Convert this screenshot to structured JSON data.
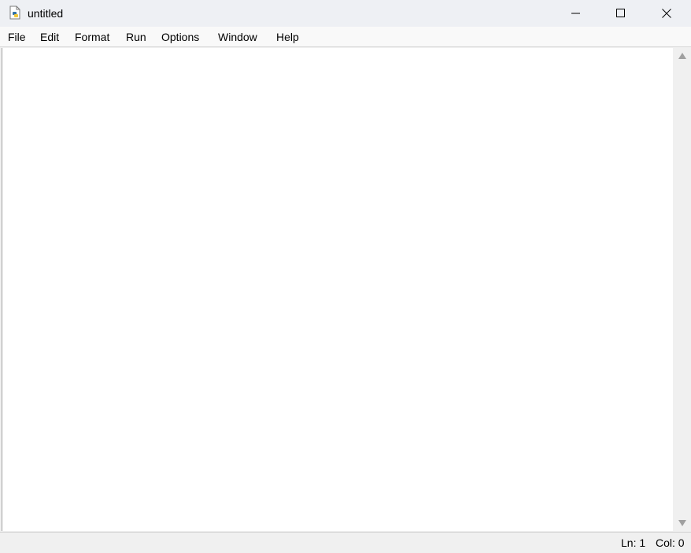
{
  "window": {
    "title": "untitled",
    "icon": "python-file-icon"
  },
  "menubar": {
    "items": [
      "File",
      "Edit",
      "Format",
      "Run",
      "Options",
      "Window",
      "Help"
    ]
  },
  "editor": {
    "content": ""
  },
  "statusbar": {
    "line": "Ln: 1",
    "column": "Col: 0"
  },
  "colors": {
    "titlebar": "#eef0f4",
    "menubar": "#f9f9f9",
    "editor_bg": "#ffffff",
    "chrome_bg": "#f0f0f0"
  }
}
